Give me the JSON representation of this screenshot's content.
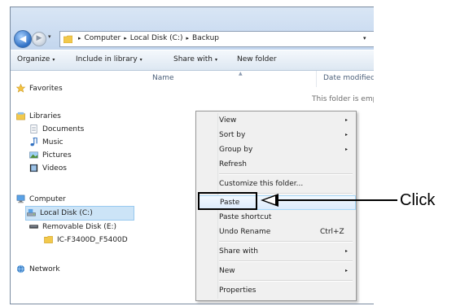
{
  "address_bar": {
    "crumbs": [
      "Computer",
      "Local Disk (C:)",
      "Backup"
    ],
    "separator": "▸",
    "dropdown": "▾"
  },
  "toolbar": {
    "organize": "Organize",
    "include_in_library": "Include in library",
    "share_with": "Share with",
    "new_folder": "New folder",
    "caret": "▾"
  },
  "sidebar": {
    "favorites": "Favorites",
    "libraries": "Libraries",
    "documents": "Documents",
    "music": "Music",
    "pictures": "Pictures",
    "videos": "Videos",
    "computer": "Computer",
    "local_disk": "Local Disk (C:)",
    "removable_disk": "Removable Disk (E:)",
    "ic_folder": "IC-F3400D_F5400D",
    "network": "Network"
  },
  "content": {
    "column_name": "Name",
    "column_date": "Date modified",
    "empty_message": "This folder is empt"
  },
  "context_menu": {
    "view": "View",
    "sort_by": "Sort by",
    "group_by": "Group by",
    "refresh": "Refresh",
    "customize": "Customize this folder...",
    "paste": "Paste",
    "paste_shortcut": "Paste shortcut",
    "undo_rename": "Undo Rename",
    "undo_shortcut": "Ctrl+Z",
    "share_with": "Share with",
    "new": "New",
    "properties": "Properties",
    "submenu_arrow": "▸"
  },
  "annotation": {
    "label": "Click"
  },
  "colors": {
    "selection": "#cce4f7",
    "menu_highlight_border": "#a8d8f8",
    "titlebar": "#c3d6ee"
  }
}
